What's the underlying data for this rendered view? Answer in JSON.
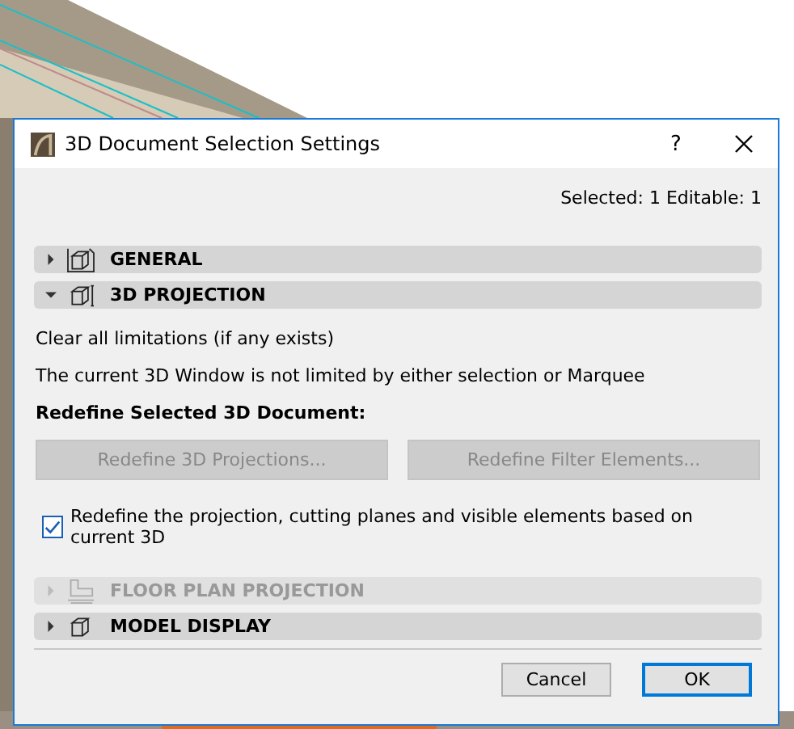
{
  "window": {
    "title": "3D Document Selection Settings",
    "help": "?"
  },
  "selection_info": "Selected: 1 Editable: 1",
  "sections_top": [
    {
      "label": "GENERAL",
      "kind": "general",
      "expanded": false,
      "disabled": false
    },
    {
      "label": "3D PROJECTION",
      "kind": "projection",
      "expanded": true,
      "disabled": false
    }
  ],
  "projection": {
    "clear_text": "Clear all limitations (if any exists)",
    "status_text": "The current 3D Window is not limited by either selection or Marquee",
    "redefine_heading": "Redefine Selected 3D Document:",
    "buttons": [
      {
        "label": "Redefine 3D Projections...",
        "disabled": true
      },
      {
        "label": "Redefine Filter Elements...",
        "disabled": true
      }
    ],
    "checkbox": {
      "label": "Redefine the projection, cutting planes and visible elements based on current 3D",
      "checked": true
    }
  },
  "sections_bottom": [
    {
      "label": "FLOOR PLAN PROJECTION",
      "kind": "floorplan",
      "expanded": false,
      "disabled": true
    },
    {
      "label": "MODEL DISPLAY",
      "kind": "model",
      "expanded": false,
      "disabled": false
    }
  ],
  "footer_buttons": [
    {
      "label": "Cancel",
      "default": false
    },
    {
      "label": "OK",
      "default": true
    }
  ]
}
